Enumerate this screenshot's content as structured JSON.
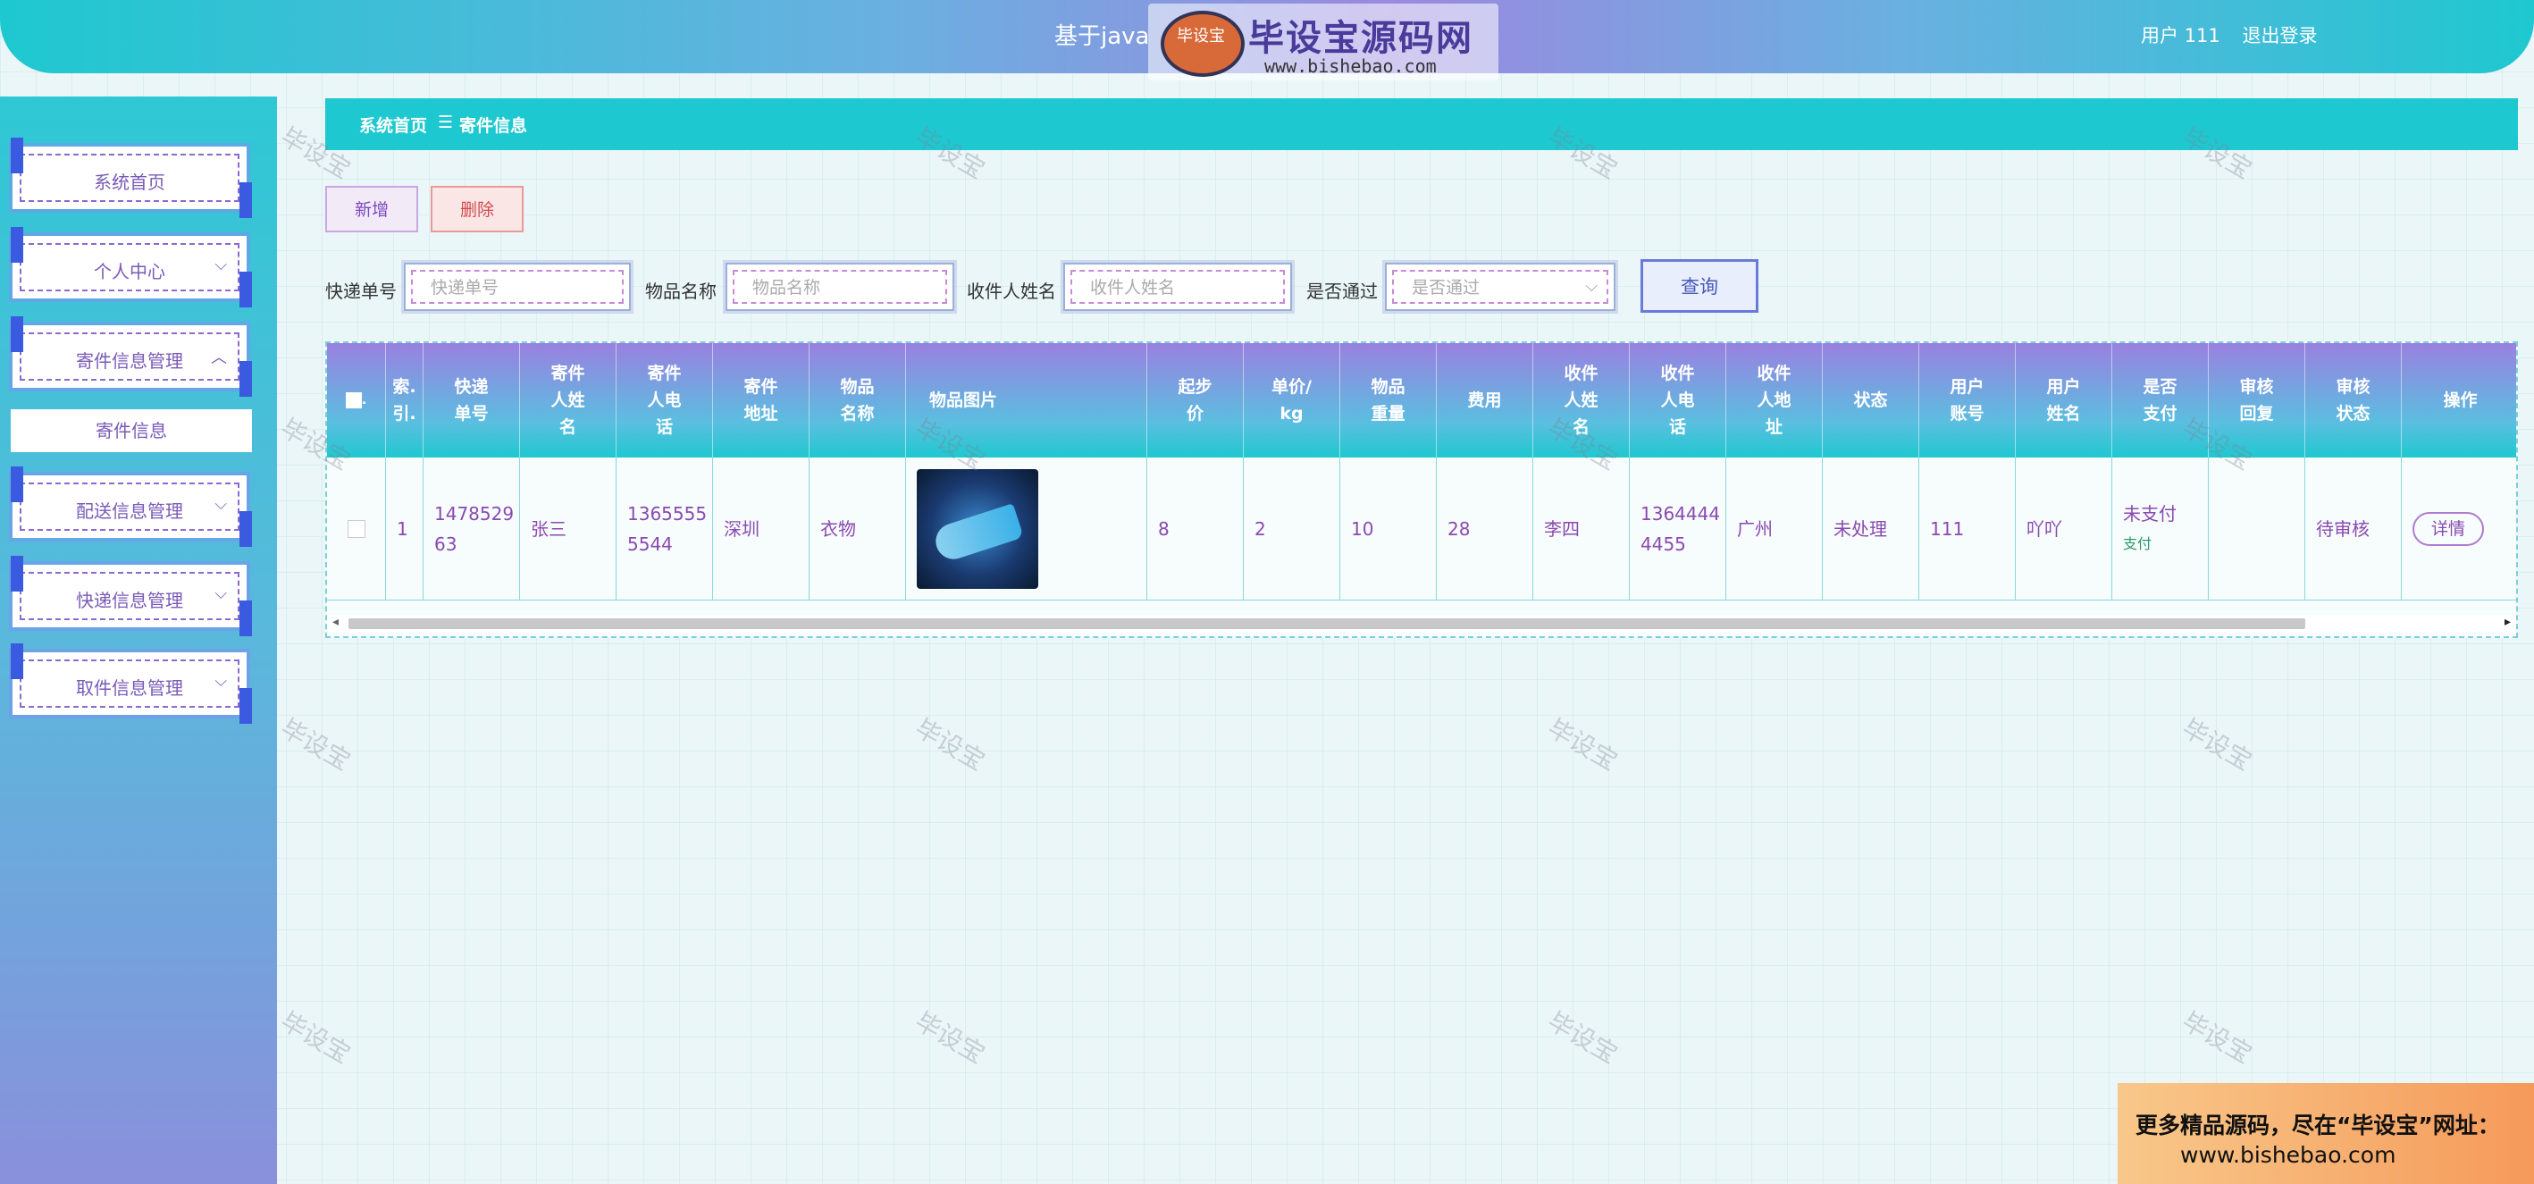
{
  "header": {
    "title": "基于java",
    "user_label": "用户 111",
    "logout": "退出登录"
  },
  "logo_watermark": {
    "badge": "毕设宝",
    "name": "毕设宝源码网",
    "url": "www.bishebao.com"
  },
  "sidebar": {
    "items": [
      {
        "label": "系统首页"
      },
      {
        "label": "个人中心"
      },
      {
        "label": "寄件信息管理"
      },
      {
        "label": "配送信息管理"
      },
      {
        "label": "快递信息管理"
      },
      {
        "label": "取件信息管理"
      }
    ],
    "subitem": "寄件信息"
  },
  "breadcrumb": {
    "home": "系统首页",
    "sep": "☰",
    "current": "寄件信息"
  },
  "actions": {
    "add": "新增",
    "delete": "删除"
  },
  "search": {
    "tracking_label": "快递单号",
    "tracking_placeholder": "快递单号",
    "item_label": "物品名称",
    "item_placeholder": "物品名称",
    "recipient_label": "收件人姓名",
    "recipient_placeholder": "收件人姓名",
    "approved_label": "是否通过",
    "approved_placeholder": "是否通过",
    "query": "查询"
  },
  "table": {
    "headers": [
      "索引",
      "快递单号",
      "寄件人姓名",
      "寄件人电话",
      "寄件地址",
      "物品名称",
      "物品图片",
      "起步价",
      "单价/kg",
      "物品重量",
      "费用",
      "收件人姓名",
      "收件人电话",
      "收件人地址",
      "状态",
      "用户账号",
      "用户姓名",
      "是否支付",
      "审核回复",
      "审核状态",
      "操作"
    ],
    "header_display": [
      "索.\n引.",
      "快递\n单号",
      "寄件\n人姓\n名",
      "寄件\n人电\n话",
      "寄件\n地址",
      "物品\n名称",
      "物品图片",
      "起步\n价",
      "单价/\nkg",
      "物品\n重量",
      "费用",
      "收件\n人姓\n名",
      "收件\n人电\n话",
      "收件\n人地\n址",
      "状态",
      "用户\n账号",
      "用户\n姓名",
      "是否\n支付",
      "审核\n回复",
      "审核\n状态",
      "操作"
    ],
    "row": {
      "index": "1",
      "tracking": "1478529\n63",
      "sender_name": "张三",
      "sender_phone": "1365555\n5544",
      "sender_address": "深圳",
      "item_name": "衣物",
      "start_price": "8",
      "unit_price": "2",
      "weight": "10",
      "fee": "28",
      "recipient_name": "李四",
      "recipient_phone": "1364444\n4455",
      "recipient_address": "广州",
      "status": "未处理",
      "account": "111",
      "user_name": "吖吖",
      "paid": "未支付",
      "pay_link": "支付",
      "review_reply": "",
      "review_status": "待审核",
      "detail": "详情"
    }
  },
  "watermark_text": "毕设宝",
  "promo": {
    "line1": "更多精品源码，尽在“毕设宝”网址：",
    "line2": "www.bishebao.com"
  },
  "colors": {
    "teal": "#1ec8d0",
    "purple": "#9a80e0",
    "text_purple": "#8a4ab0"
  }
}
